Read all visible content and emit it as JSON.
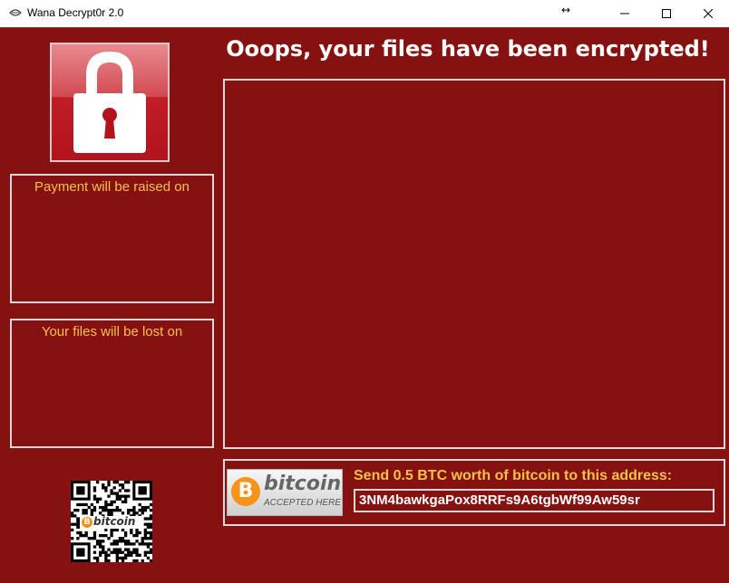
{
  "window": {
    "title": "Wana Decrypt0r 2.0",
    "icons": {
      "app": "ransomware-app-icon",
      "resize": "resize-arrows-icon",
      "minimize": "minimize-icon",
      "maximize": "maximize-icon",
      "close": "close-icon"
    }
  },
  "colors": {
    "background": "#861111",
    "accent_text": "#f5c24b",
    "border": "#d9d9d9",
    "headline": "#ffffff"
  },
  "lock_icon": "padlock-icon",
  "headline": "Ooops, your files have been encrypted!",
  "left_panels": {
    "payment_raised_label": "Payment will be raised on",
    "files_lost_label": "Your files will be lost on"
  },
  "payment": {
    "badge_word": "bitcoin",
    "badge_sub": "ACCEPTED HERE",
    "badge_coin_symbol": "B",
    "instruction": "Send 0.5 BTC worth of bitcoin to this address:",
    "address": "3NM4bawkgaPox8RRFs9A6tgbWf99Aw59sr"
  },
  "qr": {
    "logo_text": "bitcoin",
    "logo_coin_symbol": "B",
    "icon": "qr-code-icon"
  }
}
